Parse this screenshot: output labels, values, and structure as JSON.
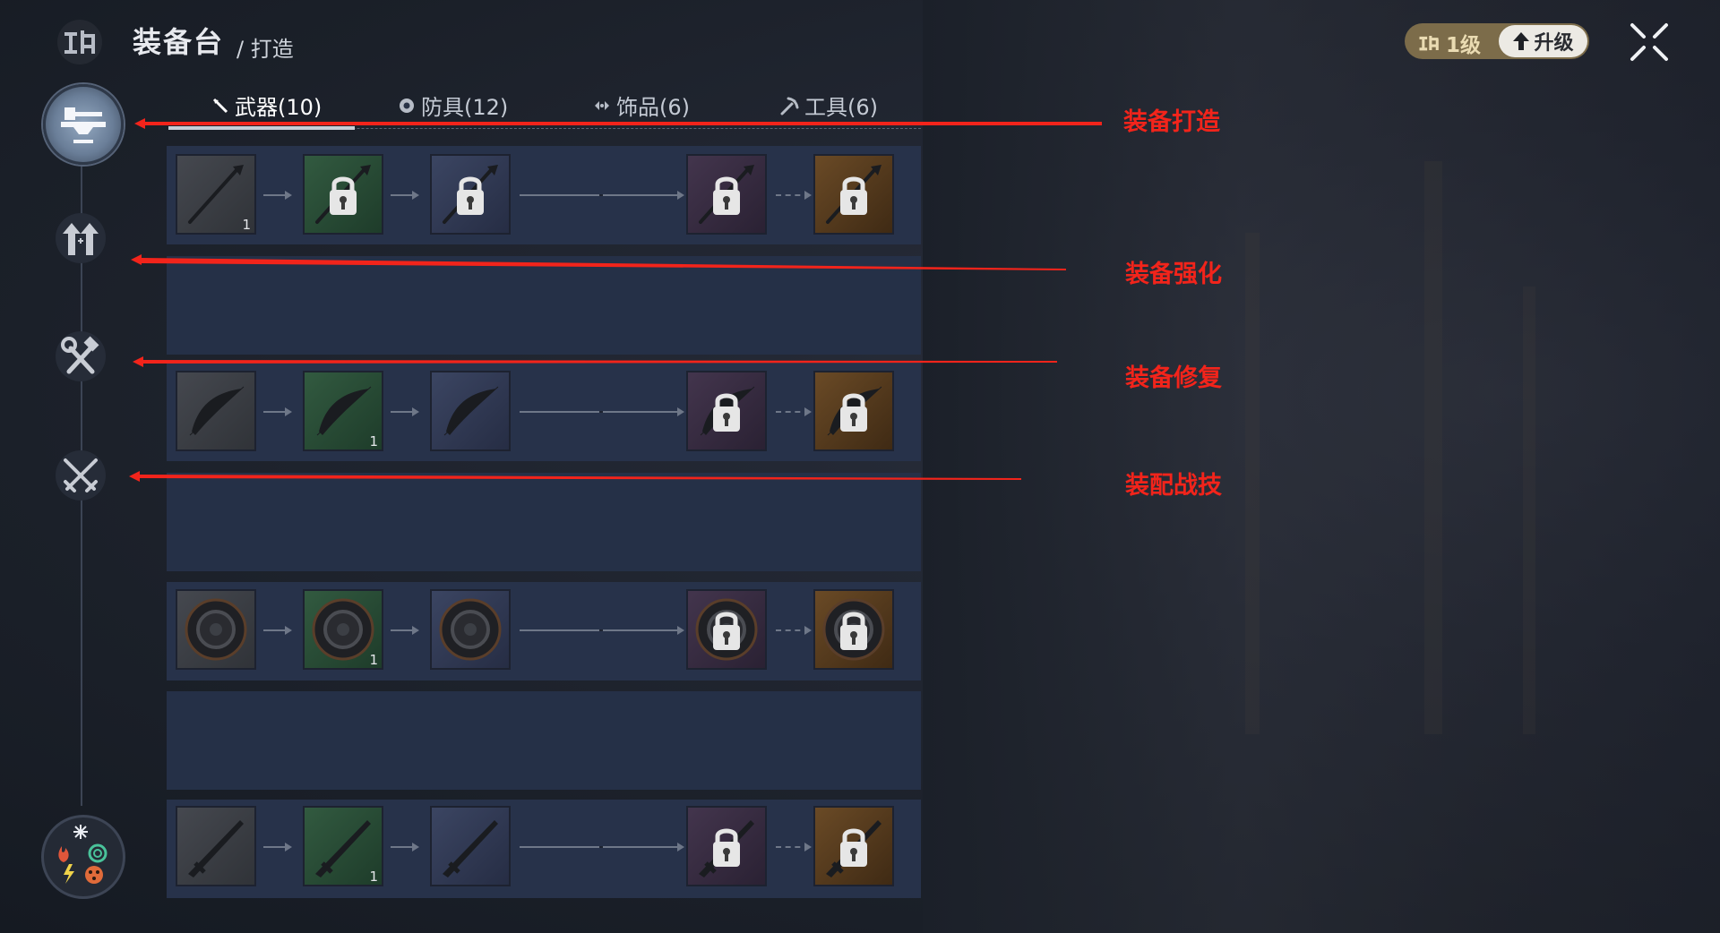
{
  "header": {
    "title": "装备台",
    "breadcrumb": "/ 打造",
    "level": "1级",
    "upgrade_label": "升级"
  },
  "tabs": [
    {
      "label": "武器(10)",
      "icon": "weapon-icon",
      "active": true
    },
    {
      "label": "防具(12)",
      "icon": "armor-icon",
      "active": false
    },
    {
      "label": "饰品(6)",
      "icon": "accessory-icon",
      "active": false
    },
    {
      "label": "工具(6)",
      "icon": "tool-icon",
      "active": false
    }
  ],
  "sidebar": [
    {
      "name": "equipment-craft",
      "icon": "anvil-icon",
      "active": true
    },
    {
      "name": "equipment-enhance",
      "icon": "upgrade-arrows-icon"
    },
    {
      "name": "equipment-repair",
      "icon": "hammer-wrench-icon"
    },
    {
      "name": "equip-skills",
      "icon": "crossed-swords-icon"
    },
    {
      "name": "elements",
      "icon": "element-wheel-icon"
    }
  ],
  "annotations": [
    "装备打造",
    "装备强化",
    "装备修复",
    "装配战技"
  ],
  "rows": [
    {
      "type": "spear",
      "slots": [
        {
          "rarity": "gray",
          "locked": false,
          "count": "1"
        },
        {
          "rarity": "green",
          "locked": true
        },
        {
          "rarity": "blue",
          "locked": true
        },
        {
          "rarity": "purple",
          "locked": true
        },
        {
          "rarity": "orange",
          "locked": true
        }
      ]
    },
    {
      "type": "bow",
      "slots": [
        {
          "rarity": "gray",
          "locked": false
        },
        {
          "rarity": "green",
          "locked": false,
          "count": "1"
        },
        {
          "rarity": "blue",
          "locked": false
        },
        {
          "rarity": "purple",
          "locked": true
        },
        {
          "rarity": "orange",
          "locked": true
        }
      ]
    },
    {
      "type": "shield",
      "slots": [
        {
          "rarity": "gray",
          "locked": false
        },
        {
          "rarity": "green",
          "locked": false,
          "count": "1"
        },
        {
          "rarity": "blue",
          "locked": false
        },
        {
          "rarity": "purple",
          "locked": true
        },
        {
          "rarity": "orange",
          "locked": true
        }
      ]
    },
    {
      "type": "sword",
      "slots": [
        {
          "rarity": "gray",
          "locked": false
        },
        {
          "rarity": "green",
          "locked": false,
          "count": "1"
        },
        {
          "rarity": "blue",
          "locked": false
        },
        {
          "rarity": "purple",
          "locked": true
        },
        {
          "rarity": "orange",
          "locked": true
        }
      ]
    }
  ],
  "colors": {
    "annotation": "#f2241b",
    "level_pill": "#7c6c4a",
    "panel": "#27324a"
  }
}
